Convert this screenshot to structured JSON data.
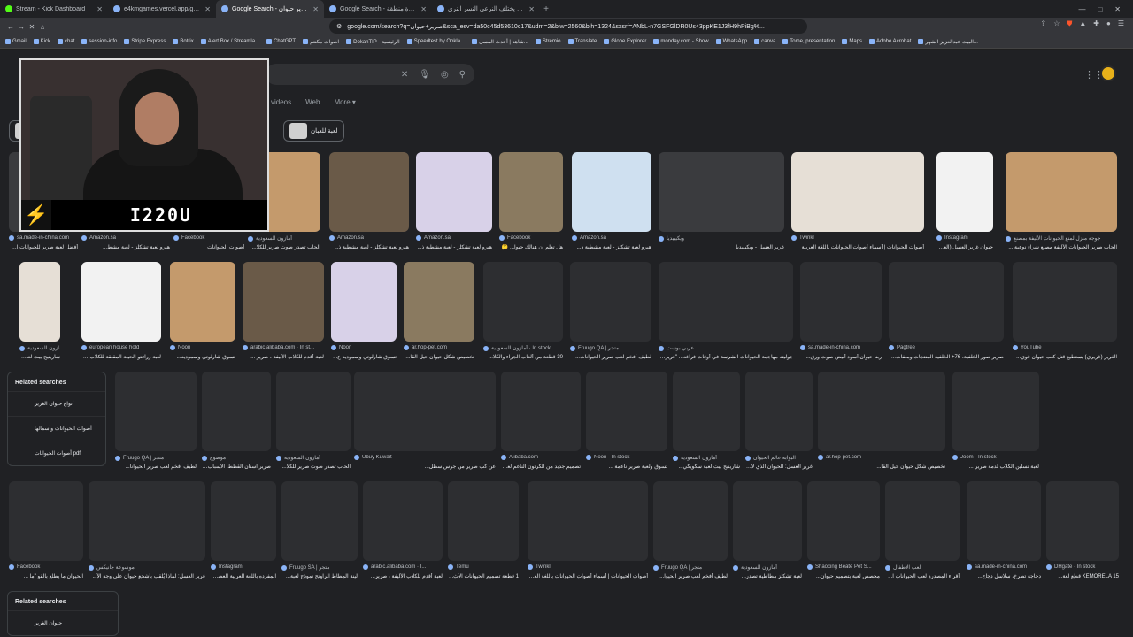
{
  "tabs": [
    {
      "title": "Stream - Kick Dashboard",
      "active": false
    },
    {
      "title": "e4kmgames.vercel.app/games/word",
      "active": false
    },
    {
      "title": "Google Search - صرير حيوان",
      "active": true
    },
    {
      "title": "Google Search - هل الجيزة منطقة",
      "active": false
    },
    {
      "title": "هل يختلف النرعي النسر النري - earch",
      "active": false
    }
  ],
  "window_controls": [
    "—",
    "□",
    "✕"
  ],
  "address": {
    "url": "google.com/search?q=صرير+حيوان&sca_esv=da50c45d53610c17&udm=2&biw=2560&bih=1324&sxsrf=ANbL-n7GSFGlDR0Us43ppKE1J3fH9hPiBg%..."
  },
  "bookmarks": [
    "Gmail",
    "Kick",
    "chat",
    "session-info",
    "Stripe Express",
    "Botrix",
    "Alert Box / Streamla...",
    "ChatGPT",
    "اصوات مكنتم",
    "DokanTIP - الرئيسية",
    "Speedtest by Ookla...",
    "شاهد | أحدث المسل...",
    "Stremio",
    "Translate",
    "Globe Explorer",
    "monday.com - Show",
    "WhatsApp",
    "canva",
    "Tome, presentation",
    "Maps",
    "Adobe Acrobat",
    "البيت عبدالعزيز الشهر..."
  ],
  "search": {
    "nav_tabs": [
      "videos",
      "Web",
      "More ▾"
    ],
    "chip": "لعبة للعبان"
  },
  "streamer": {
    "brand": "I220U"
  },
  "row1": [
    {
      "src": "sa.made-in-china.com",
      "cap": "أفضل لعبة صرير للحيوانات الأليفة ه..."
    },
    {
      "src": "Amazon.sa",
      "cap": "هيرو لعبة تشكلز - لعبة مشط..."
    },
    {
      "src": "Facebook",
      "cap": "أصوات الحيوانات"
    },
    {
      "src": "أمازون السعودية",
      "cap": "الحاب تصدر صوت صرير للكلا..."
    },
    {
      "src": "Amazon.sa",
      "cap": "هيرو لعبة تشكلز - لعبة مشطية ذ..."
    },
    {
      "src": "Amazon.sa",
      "cap": "هيرو لعبة تشكلز - لعبة مشطية ذ..."
    },
    {
      "src": "Facebook",
      "cap": "هل تعلم ان هنالك حيوا... 🤔"
    },
    {
      "src": "Amazon.sa",
      "cap": "هيرو لعبة تشكلز - لعبة مشطية ذ..."
    },
    {
      "src": "ويكيبيديا",
      "cap": "غرير العسل - ويكيبيديا"
    },
    {
      "src": "Twinkl",
      "cap": "أصوات الحيوانات | أسماء أصوات الحيوانات باللغة العربية"
    },
    {
      "src": "Instagram",
      "cap": "حيوان غرير العسل (العسلا..."
    },
    {
      "src": "جوجه منزل لمنع الحيوانات الأليفة بمصنع",
      "cap": "الحاب صرير الحيوانات الأليفة مصنع شراء نوعية ..."
    }
  ],
  "row2": [
    {
      "src": "أمازون السعودية",
      "cap": "شارينيج بيت لعبة سكويكي..."
    },
    {
      "src": "european house hold",
      "cap": "لعبة زرافتو الحيلة المقلقة للكلاب على كر..."
    },
    {
      "src": "Noon",
      "cap": "تسوق شارلوتي وسموديه..."
    },
    {
      "src": "arabic.alibaba.com · In st...",
      "cap": "لعبة أقدم للكلاب الأليفة ، صرير ..."
    },
    {
      "src": "Noon",
      "cap": "تسوق شارلوتي وسموديه ع..."
    },
    {
      "src": "ar.hop-pet.com",
      "cap": "تخصيص شكل حيوان حيل القا..."
    },
    {
      "src": "أمازون السعودية · In stock",
      "cap": "30 قطعة من ألعاب الجراء والكلا..."
    },
    {
      "src": "Fruugo QA | متجر",
      "cap": "لطيف أفخم لعب صرير الحيوانات..."
    },
    {
      "src": "عربي بوست",
      "cap": "جوليته مهاجمة الحيوانات الشرسة في أوقات فراغه... \"غرير الـ..."
    },
    {
      "src": "sa.made-in-china.com",
      "cap": "ربنا حيوان أسود أبيض صوت ورق..."
    },
    {
      "src": "Pagtree",
      "cap": "صرير صور الخلفية، 76+ الخلفية المنتجات وملفات..."
    },
    {
      "src": "YouTube",
      "cap": "الغرير (غريري) يستطيع قتل كلب حيوان قوي..."
    }
  ],
  "row3": [
    {
      "src": "Fruugo QA | متجر",
      "cap": "لطيف أفخم لعب صرير الحيوانا..."
    },
    {
      "src": "موضوع",
      "cap": "صرير أسنان القطط: الأسباب والأعراض وخيارات العلاج..."
    },
    {
      "src": "أمازون السعودية",
      "cap": "الحاب تصدر صوت صرير للكلا..."
    },
    {
      "src": "Ubuy Kuwait",
      "cap": "عن كب صرير من جرس سطل..."
    },
    {
      "src": "Alibaba.com",
      "cap": "تصميم جديد من الكرتون الناعم لعبة..."
    },
    {
      "src": "Noon · In stock",
      "cap": "تسوق ولعبة صرير ناعمة ..."
    },
    {
      "src": "أمازون السعودية",
      "cap": "شارينيج بيت لعبة سكويكي..."
    },
    {
      "src": "البوابة عالم الحيوان",
      "cap": "غرير العسل: الحيوان الذي لا يخاف أحدا أبدا!"
    },
    {
      "src": "ar.hop-pet.com",
      "cap": "تخصيص شكل حيوان حيل القا..."
    },
    {
      "src": "Joom · In stock",
      "cap": "لعبة تسلين الكلاب لدمة صرير ..."
    }
  ],
  "row4": [
    {
      "src": "Facebook",
      "cap": "الحيوان ما يطلع بالقو \"ما ..."
    },
    {
      "src": "موسوعة جانيكس",
      "cap": "غرير العسل: لماذا يُلقب بأشجع حيوان على وجه الأ..."
    },
    {
      "src": "Instagram",
      "cap": "المفرده باللغة العربية العصف..."
    },
    {
      "src": "Fruugo SA | متجر",
      "cap": "لينة المطاط الراونج نموذج لعبة..."
    },
    {
      "src": "arabic.alibaba.com · I...",
      "cap": "لعبة أقدم للكلاب الأليفة ، صرير..."
    },
    {
      "src": "Temu",
      "cap": "1 قطعة تصميم الحيوانات الأث..."
    },
    {
      "src": "Twinkl",
      "cap": "أصوات الحيوانات | أسماء أصوات الحيوانات باللغة العربية"
    },
    {
      "src": "Fruugo QA | متجر",
      "cap": "لطيف أفخم لعب صرير الحيوا..."
    },
    {
      "src": "أمازون السعودية",
      "cap": "لعبة تشكلز مطاطية تصدر..."
    },
    {
      "src": "Shaoxing Beate Pet S...",
      "cap": "مخصص لعبة بتصميم حيوان..."
    },
    {
      "src": "لعب الأطفال",
      "cap": "أقراء المصدرة لعب الحيوانات ا..."
    },
    {
      "src": "sa.made-in-china.com",
      "cap": "دجاجة تصرخ، سلاسل دجاج..."
    },
    {
      "src": "DHgate · In stock",
      "cap": "KEMORELA 15 قطع لعة..."
    }
  ],
  "related1": {
    "title": "Related searches",
    "items": [
      "أنواع حيوان الغرير",
      "أصوات الحيوانات وأسمائها",
      "أصوات الحيوانات pdf"
    ]
  },
  "related2": {
    "title": "Related searches",
    "items": [
      "حيوان الغرير"
    ]
  }
}
